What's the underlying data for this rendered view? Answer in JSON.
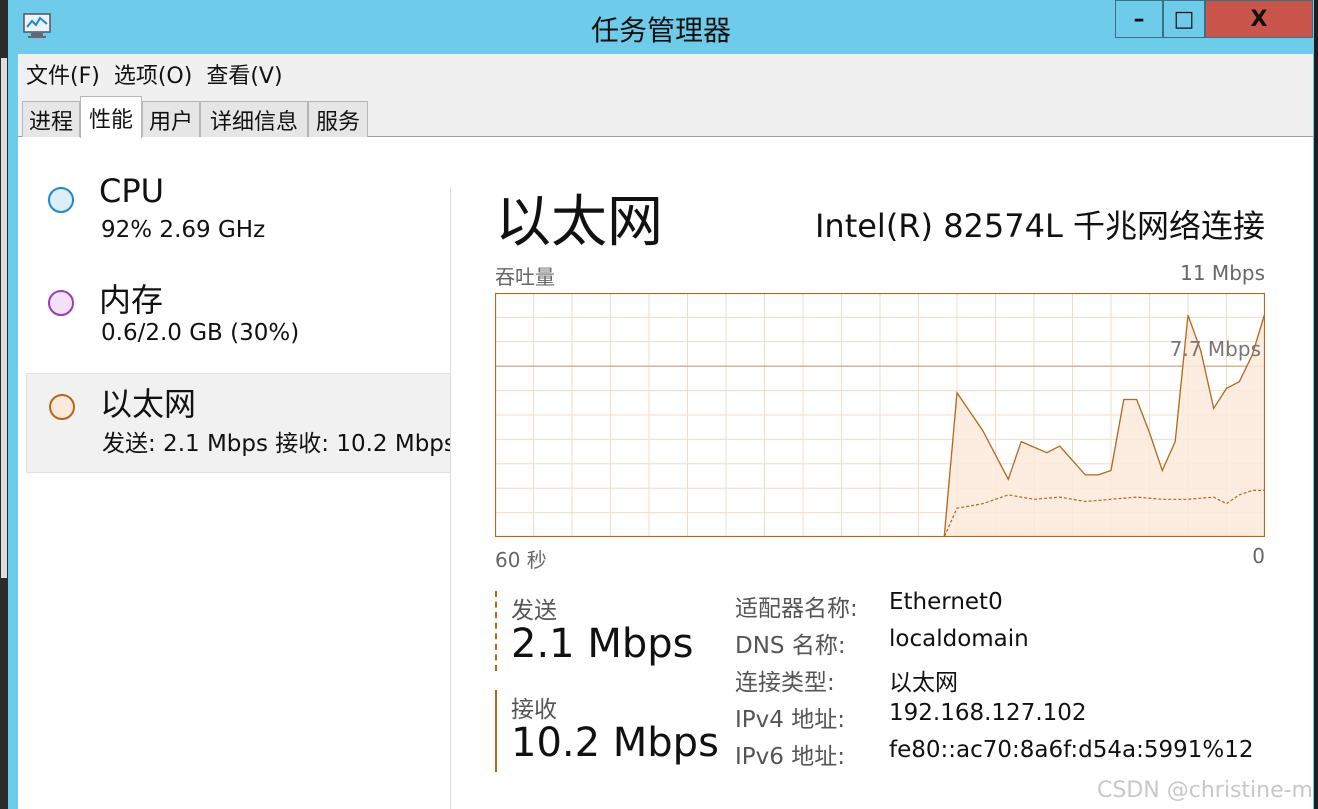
{
  "window": {
    "title": "任务管理器",
    "controls": {
      "minimize": "–",
      "maximize": "□",
      "close": "X"
    }
  },
  "menu": [
    "文件(F)",
    "选项(O)",
    "查看(V)"
  ],
  "tabs": [
    {
      "label": "进程",
      "active": false
    },
    {
      "label": "性能",
      "active": true
    },
    {
      "label": "用户",
      "active": false
    },
    {
      "label": "详细信息",
      "active": false
    },
    {
      "label": "服务",
      "active": false
    }
  ],
  "sidebar": {
    "items": [
      {
        "title": "CPU",
        "sub": "92%  2.69 GHz",
        "color": "#1e88c8",
        "selected": false
      },
      {
        "title": "内存",
        "sub": "0.6/2.0 GB (30%)",
        "color": "#9b3bb6",
        "selected": false
      },
      {
        "title": "以太网",
        "sub": "发送: 2.1 Mbps  接收: 10.2 Mbps",
        "color": "#b5661a",
        "selected": true
      }
    ]
  },
  "detail": {
    "title": "以太网",
    "adapter": "Intel(R) 82574L 千兆网络连接",
    "throughput_label": "吞吐量",
    "max_label": "11 Mbps",
    "gridline_label": "7.7 Mbps",
    "time_left": "60 秒",
    "time_right": "0",
    "send_label": "发送",
    "send_value": "2.1 Mbps",
    "recv_label": "接收",
    "recv_value": "10.2 Mbps",
    "properties": [
      {
        "key": "适配器名称:",
        "value": "Ethernet0"
      },
      {
        "key": "DNS 名称:",
        "value": "localdomain"
      },
      {
        "key": "连接类型:",
        "value": "以太网"
      },
      {
        "key": "IPv4 地址:",
        "value": "192.168.127.102"
      },
      {
        "key": "IPv6 地址:",
        "value": "fe80::ac70:8a6f:d54a:5991%12"
      }
    ]
  },
  "chart_data": {
    "type": "area",
    "x_unit": "seconds ago",
    "ylim": [
      0,
      11
    ],
    "grid": true,
    "series": [
      {
        "name": "接收",
        "color": "#b5661a",
        "style": "solid",
        "x": [
          60,
          25,
          24,
          22,
          20,
          19,
          17,
          16,
          14,
          13,
          12,
          11,
          10,
          9,
          8,
          7,
          6,
          5,
          4,
          3,
          2,
          1,
          0
        ],
        "y": [
          0,
          0,
          6.5,
          4.8,
          2.6,
          4.3,
          3.8,
          4.1,
          2.8,
          2.8,
          3.0,
          6.2,
          6.2,
          4.7,
          3.0,
          4.3,
          10.0,
          8.4,
          5.8,
          6.7,
          7.0,
          8.2,
          10.1
        ]
      },
      {
        "name": "发送",
        "color": "#b5661a",
        "style": "dashed",
        "x": [
          60,
          25,
          24,
          22,
          20,
          18,
          16,
          14,
          12,
          10,
          8,
          6,
          4,
          3,
          2,
          1,
          0
        ],
        "y": [
          0,
          0,
          1.3,
          1.5,
          1.9,
          1.7,
          1.8,
          1.6,
          1.7,
          1.8,
          1.7,
          1.7,
          1.8,
          1.5,
          1.9,
          2.1,
          2.1
        ]
      }
    ]
  }
}
